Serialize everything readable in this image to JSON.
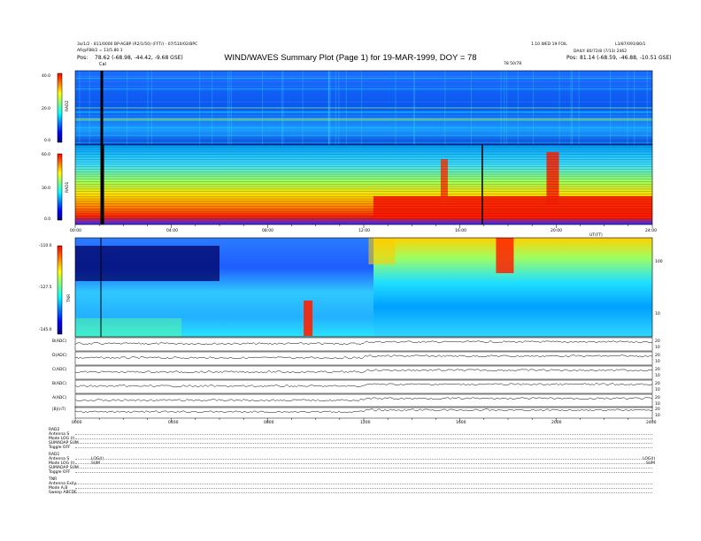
{
  "header": {
    "title": "WIND/WAVES Summary Plot (Page 1) for 19-MAR-1999, DOY = 78",
    "left_line1": "3a/1/2 - 811/0000 BP-AGBP (R2/1/50) (FFT/) - 07/510/02/BPC",
    "left_line2": "AR@F88/2 = 13/5.80.1",
    "left_pos_label": "Pos:",
    "left_pos_value": "78.62 (-68.98, -44.42, -9.68 GSE)",
    "right_line1": "L3/87/091/80/1",
    "right_line2": "DAILY: 80/72/8 (7/13) 2462",
    "right_pos_label": "Pos:",
    "right_pos_value": "81.14 (-68.59, -46.88, -10.51 GSE)",
    "mid_right_line": "1.10 WED 19 FOIL",
    "mid_right_small": "78 50/78",
    "cal_label": "Cal"
  },
  "colors": {
    "spectrogram_scale": [
      "#00007f",
      "#0000ff",
      "#007fff",
      "#00ffff",
      "#7fff7f",
      "#ffff00",
      "#ff7f00",
      "#ff0000"
    ],
    "timeseries_line": "#000000"
  },
  "panels": {
    "rad2": {
      "label": "RAD2",
      "ticks": [
        "40.0",
        "20.0",
        "0.0"
      ]
    },
    "rad1": {
      "label": "RAD1",
      "ticks": [
        "60.0",
        "30.0",
        "0.0"
      ]
    },
    "tnr": {
      "label": "TNR",
      "ticks": [
        "-110.0",
        "-127.5",
        "-145.0"
      ],
      "right_ticks": [
        "100",
        "10"
      ]
    },
    "time_ticks_upper": [
      "00:00",
      "04:00",
      "08:00",
      "12:00",
      "16:00",
      "20:00",
      "24:00"
    ],
    "upper_axis_tag": "UT(FT)",
    "time_ticks_lower": [
      "0000",
      "0400",
      "0800",
      "1200",
      "1600",
      "2000",
      "2400"
    ],
    "timeseries": [
      {
        "label": "B(ADC)",
        "right_ticks": [
          "20",
          "10"
        ]
      },
      {
        "label": "D(ADC)",
        "right_ticks": [
          "20",
          "10"
        ]
      },
      {
        "label": "C(ADC)",
        "right_ticks": [
          "20",
          "10"
        ]
      },
      {
        "label": "B(ADC)",
        "right_ticks": [
          "20",
          "10"
        ]
      },
      {
        "label": "A(ADC)",
        "right_ticks": [
          "20",
          "10"
        ]
      },
      {
        "label": "|B|(nT)",
        "right_ticks": [
          "20",
          "10"
        ]
      }
    ]
  },
  "status": {
    "rad2_block": [
      "RAD2",
      "Antenna   S",
      "Mode    LOG (I)",
      "SUMADAP  SUM",
      "Toggle    OFF"
    ],
    "rad1_block": [
      "RAD1",
      "Antenna   S",
      "Mode  LOG (I)",
      "SUMADAP  SUM",
      "Toggle    OFF"
    ],
    "tnr_block": [
      "TNR",
      "Antenna   Exily",
      "Mode    A,B",
      "Sweep  ABCDE"
    ],
    "rad1_mode_mid": "LOG(I)",
    "rad1_sum_mid": "SUM",
    "rad1_mode_right": "LOG(I)",
    "rad1_sum_right": "SUM"
  },
  "chart_data": [
    {
      "type": "heatmap",
      "title": "RAD2",
      "ylabel": "RAD2",
      "ylim": [
        0,
        40
      ],
      "x_range_hours": [
        0,
        24
      ],
      "x_tick_labels": [
        "00:00",
        "04:00",
        "08:00",
        "12:00",
        "16:00",
        "20:00",
        "24:00"
      ],
      "description_level": "mostly blue/cyan intensity with yellow-red narrow bands near 30-40"
    },
    {
      "type": "heatmap",
      "title": "RAD1",
      "ylabel": "RAD1",
      "ylim": [
        0,
        60
      ],
      "x_range_hours": [
        0,
        24
      ],
      "x_tick_labels": [
        "00:00",
        "04:00",
        "08:00",
        "12:00",
        "16:00",
        "20:00",
        "24:00"
      ],
      "events_hours": [
        16.9
      ]
    },
    {
      "type": "heatmap",
      "title": "TNR",
      "ylabel": "TNR",
      "ylim": [
        -145,
        -110
      ],
      "x_range_hours": [
        0,
        24
      ]
    },
    {
      "type": "line",
      "x_tick_labels": [
        "0000",
        "0400",
        "0800",
        "1200",
        "1600",
        "2000",
        "2400"
      ],
      "series": [
        {
          "name": "B(ADC)"
        },
        {
          "name": "D(ADC)"
        },
        {
          "name": "C(ADC)"
        },
        {
          "name": "B(ADC)"
        },
        {
          "name": "A(ADC)"
        },
        {
          "name": "|B|(nT)"
        }
      ]
    }
  ]
}
